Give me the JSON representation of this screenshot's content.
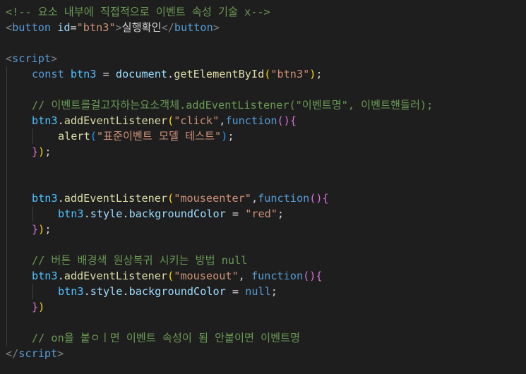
{
  "editor": {
    "lines": [
      {
        "tokens": [
          {
            "t": "<!-- 요소 내부에 직접적으로 이벤트 속성 기술 x-->",
            "c": "comment"
          }
        ]
      },
      {
        "tokens": [
          {
            "t": "<",
            "c": "punct"
          },
          {
            "t": "button",
            "c": "tag"
          },
          {
            "t": " ",
            "c": "text"
          },
          {
            "t": "id",
            "c": "attr"
          },
          {
            "t": "=",
            "c": "text"
          },
          {
            "t": "\"btn3\"",
            "c": "str"
          },
          {
            "t": ">",
            "c": "punct"
          },
          {
            "t": "실행확인",
            "c": "text"
          },
          {
            "t": "</",
            "c": "punct"
          },
          {
            "t": "button",
            "c": "tag"
          },
          {
            "t": ">",
            "c": "punct"
          }
        ]
      },
      {
        "tokens": []
      },
      {
        "tokens": [
          {
            "t": "<",
            "c": "punct"
          },
          {
            "t": "script",
            "c": "tag"
          },
          {
            "t": ">",
            "c": "punct"
          }
        ]
      },
      {
        "indent": 1,
        "tokens": [
          {
            "t": "const",
            "c": "kw"
          },
          {
            "t": " ",
            "c": "text"
          },
          {
            "t": "btn3",
            "c": "var"
          },
          {
            "t": " = ",
            "c": "op"
          },
          {
            "t": "document",
            "c": "prop"
          },
          {
            "t": ".",
            "c": "text"
          },
          {
            "t": "getElementById",
            "c": "fn"
          },
          {
            "t": "(",
            "c": "b1"
          },
          {
            "t": "\"btn3\"",
            "c": "str"
          },
          {
            "t": ")",
            "c": "b1"
          },
          {
            "t": ";",
            "c": "text"
          }
        ]
      },
      {
        "indent": 1,
        "tokens": []
      },
      {
        "indent": 1,
        "tokens": [
          {
            "t": "// 이벤트를걸고자하는요소객체.addEventListener(\"이벤트명\", 이벤트핸들러);",
            "c": "comment"
          }
        ]
      },
      {
        "indent": 1,
        "tokens": [
          {
            "t": "btn3",
            "c": "var"
          },
          {
            "t": ".",
            "c": "text"
          },
          {
            "t": "addEventListener",
            "c": "fn"
          },
          {
            "t": "(",
            "c": "b1"
          },
          {
            "t": "\"click\"",
            "c": "str"
          },
          {
            "t": ",",
            "c": "text"
          },
          {
            "t": "function",
            "c": "kw"
          },
          {
            "t": "()",
            "c": "b2"
          },
          {
            "t": "{",
            "c": "b2"
          }
        ]
      },
      {
        "indent": 2,
        "tokens": [
          {
            "t": "alert",
            "c": "fn"
          },
          {
            "t": "(",
            "c": "b3"
          },
          {
            "t": "\"표준이벤트 모델 테스트\"",
            "c": "str"
          },
          {
            "t": ")",
            "c": "b3"
          },
          {
            "t": ";",
            "c": "text"
          }
        ]
      },
      {
        "indent": 1,
        "tokens": [
          {
            "t": "}",
            "c": "b2"
          },
          {
            "t": ")",
            "c": "b1"
          },
          {
            "t": ";",
            "c": "text"
          }
        ]
      },
      {
        "indent": 1,
        "tokens": []
      },
      {
        "indent": 1,
        "tokens": []
      },
      {
        "indent": 1,
        "tokens": [
          {
            "t": "btn3",
            "c": "var"
          },
          {
            "t": ".",
            "c": "text"
          },
          {
            "t": "addEventListener",
            "c": "fn"
          },
          {
            "t": "(",
            "c": "b1"
          },
          {
            "t": "\"mouseenter\"",
            "c": "str"
          },
          {
            "t": ",",
            "c": "text"
          },
          {
            "t": "function",
            "c": "kw"
          },
          {
            "t": "()",
            "c": "b2"
          },
          {
            "t": "{",
            "c": "b2"
          }
        ]
      },
      {
        "indent": 2,
        "tokens": [
          {
            "t": "btn3",
            "c": "var"
          },
          {
            "t": ".",
            "c": "text"
          },
          {
            "t": "style",
            "c": "prop"
          },
          {
            "t": ".",
            "c": "text"
          },
          {
            "t": "backgroundColor",
            "c": "prop"
          },
          {
            "t": " = ",
            "c": "op"
          },
          {
            "t": "\"red\"",
            "c": "str"
          },
          {
            "t": ";",
            "c": "text"
          }
        ]
      },
      {
        "indent": 1,
        "tokens": [
          {
            "t": "}",
            "c": "b2"
          },
          {
            "t": ")",
            "c": "b1"
          },
          {
            "t": ";",
            "c": "text"
          }
        ]
      },
      {
        "indent": 1,
        "tokens": []
      },
      {
        "indent": 1,
        "tokens": [
          {
            "t": "// 버튼 배경색 원상복귀 시키는 방법 null",
            "c": "comment"
          }
        ]
      },
      {
        "indent": 1,
        "tokens": [
          {
            "t": "btn3",
            "c": "var"
          },
          {
            "t": ".",
            "c": "text"
          },
          {
            "t": "addEventListener",
            "c": "fn"
          },
          {
            "t": "(",
            "c": "b1"
          },
          {
            "t": "\"mouseout\"",
            "c": "str"
          },
          {
            "t": ", ",
            "c": "text"
          },
          {
            "t": "function",
            "c": "kw"
          },
          {
            "t": "()",
            "c": "b2"
          },
          {
            "t": "{",
            "c": "b2"
          }
        ]
      },
      {
        "indent": 2,
        "tokens": [
          {
            "t": "btn3",
            "c": "var"
          },
          {
            "t": ".",
            "c": "text"
          },
          {
            "t": "style",
            "c": "prop"
          },
          {
            "t": ".",
            "c": "text"
          },
          {
            "t": "backgroundColor",
            "c": "prop"
          },
          {
            "t": " = ",
            "c": "op"
          },
          {
            "t": "null",
            "c": "kw"
          },
          {
            "t": ";",
            "c": "text"
          }
        ]
      },
      {
        "indent": 1,
        "tokens": [
          {
            "t": "}",
            "c": "b2"
          },
          {
            "t": ")",
            "c": "b1"
          }
        ]
      },
      {
        "indent": 1,
        "tokens": []
      },
      {
        "indent": 1,
        "tokens": [
          {
            "t": "// on을 붙ㅇㅣ면 이벤트 속성이 됨 안붙이면 이벤트명",
            "c": "comment"
          }
        ]
      },
      {
        "tokens": [
          {
            "t": "</",
            "c": "punct"
          },
          {
            "t": "script",
            "c": "tag"
          },
          {
            "t": ">",
            "c": "punct"
          }
        ]
      }
    ]
  }
}
